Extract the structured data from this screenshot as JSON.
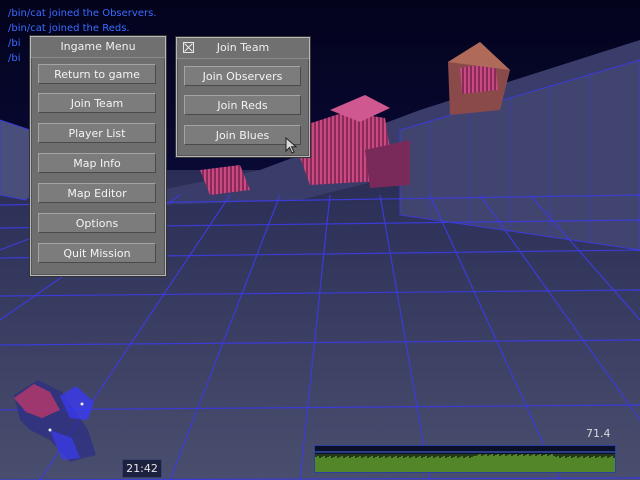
{
  "chat": {
    "lines": [
      "/bin/cat joined the Observers.",
      "/bin/cat joined the Reds.",
      "/bi",
      "/bi"
    ]
  },
  "ingame_menu": {
    "title": "Ingame Menu",
    "buttons": [
      "Return to game",
      "Join Team",
      "Player List",
      "Map Info",
      "Map Editor",
      "Options",
      "Quit Mission"
    ]
  },
  "join_team": {
    "title": "Join Team",
    "buttons": [
      "Join Observers",
      "Join Reds",
      "Join Blues"
    ]
  },
  "hud": {
    "clock": "21:42",
    "fps": "71.4"
  },
  "colors": {
    "grid": "#3b3bd6",
    "red_team": "#c8386a",
    "blue_team": "#3a3aff",
    "netgraph_bar": "#7fd23a"
  }
}
